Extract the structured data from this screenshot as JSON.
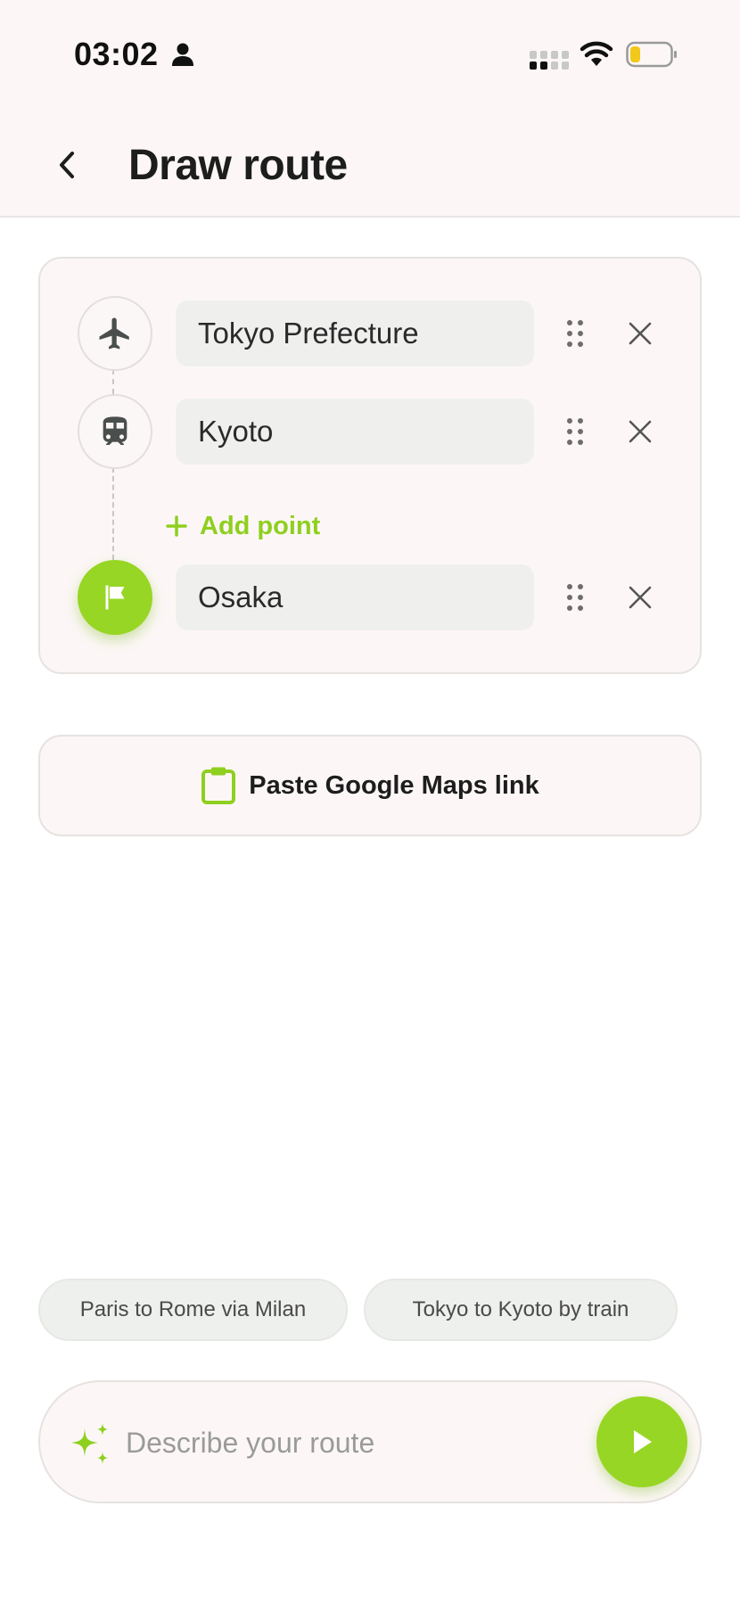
{
  "status_bar": {
    "time": "03:02",
    "icons": [
      "person-icon",
      "signal-icon",
      "wifi-icon",
      "battery-icon"
    ]
  },
  "header": {
    "title": "Draw route",
    "back_icon": "chevron-left-icon"
  },
  "route": {
    "points": [
      {
        "value": "Tokyo Prefecture",
        "icon": "airplane-icon"
      },
      {
        "value": "Kyoto",
        "icon": "train-icon"
      },
      {
        "value": "Osaka",
        "icon": "flag-icon"
      }
    ],
    "add_point_label": "Add point"
  },
  "paste": {
    "label": "Paste Google Maps link",
    "icon": "clipboard-icon"
  },
  "suggestions": [
    {
      "label": "Paris to Rome via Milan"
    },
    {
      "label": "Tokyo to Kyoto by train"
    }
  ],
  "prompt": {
    "placeholder": "Describe your route",
    "value": ""
  },
  "colors": {
    "accent": "#97d624",
    "background": "#fcf7f6",
    "field": "#eff0ee"
  }
}
